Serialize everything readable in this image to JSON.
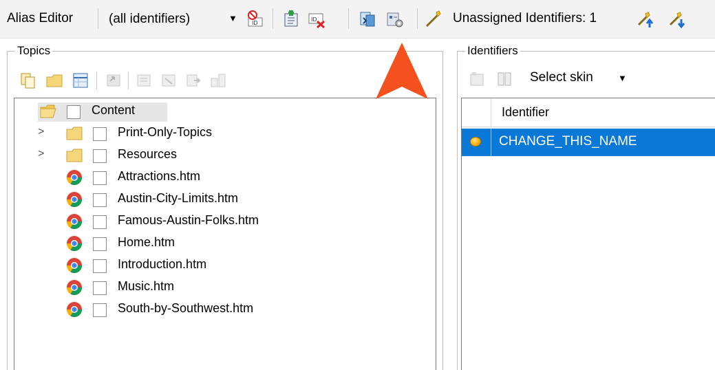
{
  "toolbar": {
    "title": "Alias Editor",
    "filter_value": "(all identifiers)",
    "unassigned_label": "Unassigned Identifiers: 1",
    "icons": [
      "filter-id-icon",
      "new-alias-icon",
      "delete-id-icon",
      "link-icon",
      "settings-icon",
      "assign-icon",
      "move-up-icon",
      "move-down-icon"
    ]
  },
  "topics": {
    "label": "Topics",
    "root": "Content",
    "items": [
      {
        "label": "Print-Only-Topics",
        "type": "folder"
      },
      {
        "label": "Resources",
        "type": "folder"
      },
      {
        "label": "Attractions.htm",
        "type": "file"
      },
      {
        "label": "Austin-City-Limits.htm",
        "type": "file"
      },
      {
        "label": "Famous-Austin-Folks.htm",
        "type": "file"
      },
      {
        "label": "Home.htm",
        "type": "file"
      },
      {
        "label": "Introduction.htm",
        "type": "file"
      },
      {
        "label": "Music.htm",
        "type": "file"
      },
      {
        "label": "South-by-Southwest.htm",
        "type": "file"
      }
    ]
  },
  "identifiers": {
    "label": "Identifiers",
    "skin_label": "Select skin",
    "column_header": "Identifier",
    "rows": [
      "CHANGE_THIS_NAME"
    ]
  },
  "colors": {
    "selection": "#0a78d7",
    "callout": "#f4511e",
    "folder": "#f5d67b"
  }
}
